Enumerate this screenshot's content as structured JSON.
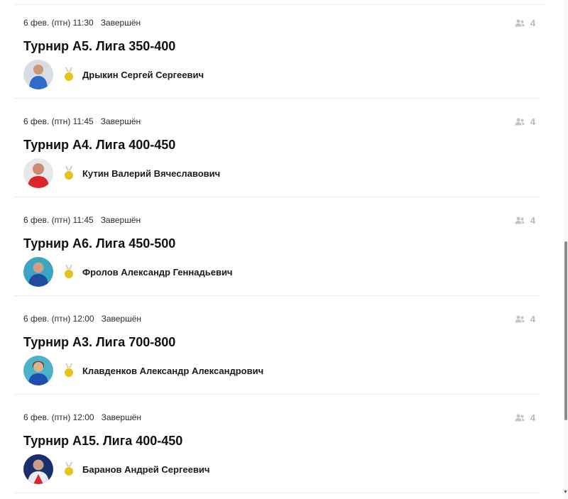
{
  "colors": {
    "medal": "#e6c419",
    "muted": "#b8b8b8",
    "divider": "#ececec"
  },
  "tournaments": [
    {
      "datetime": "6 фев. (птн) 11:30",
      "status": "Завершён",
      "participants": "4",
      "participants_icon": "users-icon",
      "title": "Турнир А5. Лига 350-400",
      "winner": "Дрыкин Сергей Сергеевич",
      "medal_icon": "gold-medal-icon",
      "avatar_color": "#2f6cc9"
    },
    {
      "datetime": "6 фев. (птн) 11:45",
      "status": "Завершён",
      "participants": "4",
      "participants_icon": "users-icon",
      "title": "Турнир А4. Лига 400-450",
      "winner": "Кутин Валерий Вячеславович",
      "medal_icon": "gold-medal-icon",
      "avatar_color": "#d8262a"
    },
    {
      "datetime": "6 фев. (птн) 11:45",
      "status": "Завершён",
      "participants": "4",
      "participants_icon": "users-icon",
      "title": "Турнир А6. Лига 450-500",
      "winner": "Фролов Александр Геннадьевич",
      "medal_icon": "gold-medal-icon",
      "avatar_color": "#1f4c9e"
    },
    {
      "datetime": "6 фев. (птн) 12:00",
      "status": "Завершён",
      "participants": "4",
      "participants_icon": "users-icon",
      "title": "Турнир А3. Лига 700-800",
      "winner": "Клавденков Александр Александрович",
      "medal_icon": "gold-medal-icon",
      "avatar_color": "#1d4fb0"
    },
    {
      "datetime": "6 фев. (птн) 12:00",
      "status": "Завершён",
      "participants": "4",
      "participants_icon": "users-icon",
      "title": "Турнир А15. Лига 400-450",
      "winner": "Баранов Андрей Сергеевич",
      "medal_icon": "gold-medal-icon",
      "avatar_color": "#1b2f6e"
    }
  ]
}
